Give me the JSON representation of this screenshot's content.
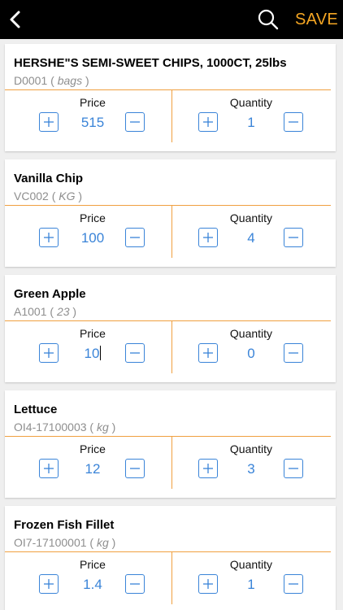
{
  "header": {
    "save_label": "SAVE",
    "icons": {
      "back": "chevron-left-icon",
      "search": "search-icon"
    }
  },
  "columns": {
    "price": "Price",
    "quantity": "Quantity"
  },
  "colors": {
    "header_bg": "#000000",
    "accent": "#f5a623",
    "value": "#3a84d8",
    "line": "#f0a040"
  },
  "items": [
    {
      "name": "HERSHE\"S SEMI-SWEET CHIPS, 1000CT, 25lbs",
      "code": "D0001",
      "unit": "bags",
      "price": "515",
      "quantity": "1"
    },
    {
      "name": "Vanilla Chip",
      "code": "VC002",
      "unit": "KG",
      "price": "100",
      "quantity": "4"
    },
    {
      "name": "Green Apple",
      "code": "A1001",
      "unit": "23",
      "price": "10",
      "quantity": "0"
    },
    {
      "name": "Lettuce",
      "code": "OI4-17100003",
      "unit": "kg",
      "price": "12",
      "quantity": "3"
    },
    {
      "name": "Frozen Fish Fillet",
      "code": "OI7-17100001",
      "unit": "kg",
      "price": "1.4",
      "quantity": "1"
    }
  ]
}
